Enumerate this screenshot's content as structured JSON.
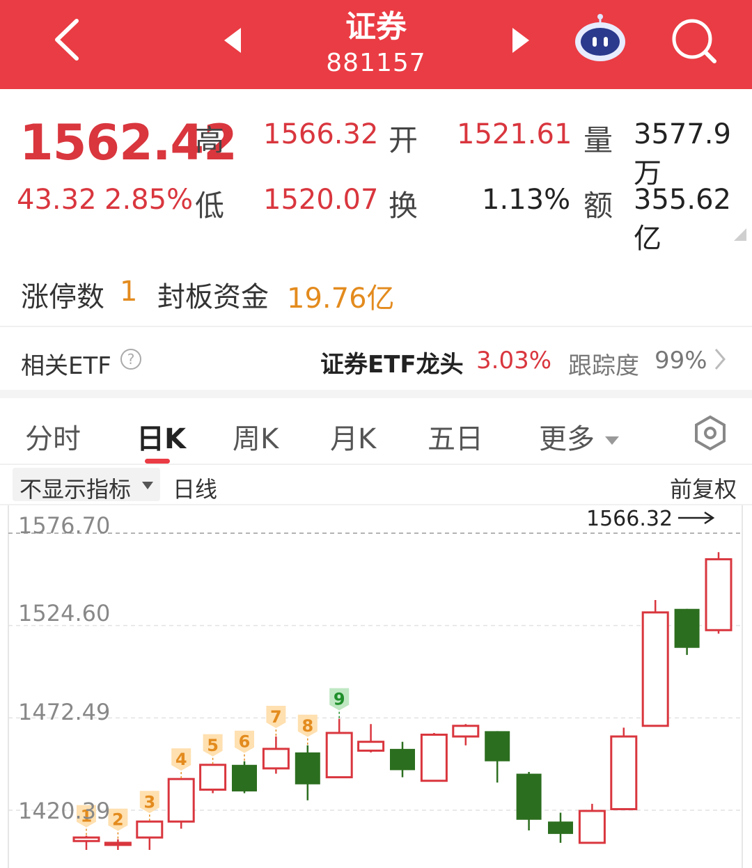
{
  "header": {
    "title": "证券",
    "code": "881157",
    "back_icon": "chevron-left-icon",
    "prev_icon": "triangle-left-icon",
    "next_icon": "triangle-right-icon",
    "robot_icon": "robot-assistant-icon",
    "search_icon": "search-icon"
  },
  "quote": {
    "price": "1562.42",
    "change": "43.32",
    "change_pct": "2.85%",
    "high_label": "高",
    "high": "1566.32",
    "low_label": "低",
    "low": "1520.07",
    "open_label": "开",
    "open": "1521.61",
    "turnover_label": "换",
    "turnover": "1.13%",
    "volume_label": "量",
    "volume": "3577.9万",
    "amount_label": "额",
    "amount": "355.62亿"
  },
  "limit": {
    "count_label": "涨停数",
    "count": "1",
    "fund_label": "封板资金",
    "fund": "19.76亿"
  },
  "etf": {
    "label": "相关ETF",
    "name": "证券ETF龙头",
    "change": "3.03%",
    "tracking_label": "跟踪度",
    "tracking": "99%"
  },
  "tabs": [
    "分时",
    "日K",
    "周K",
    "月K",
    "五日",
    "更多"
  ],
  "chart_header": {
    "indicator": "不显示指标",
    "period": "日线",
    "adjust": "前复权",
    "high_marker": "1566.32"
  },
  "colors": {
    "brand": "#ea3c44",
    "up": "#d9363e",
    "down": "#2c6e1f",
    "orange": "#e38b1e"
  },
  "chart_data": {
    "type": "candlestick",
    "y_ticks": [
      "1576.70",
      "1524.60",
      "1472.49",
      "1420.39"
    ],
    "ylim": [
      1402,
      1590
    ],
    "candles": [
      {
        "o": 1403,
        "h": 1406,
        "l": 1398,
        "c": 1405
      },
      {
        "o": 1401,
        "h": 1404,
        "l": 1398,
        "c": 1402
      },
      {
        "o": 1405,
        "h": 1414,
        "l": 1398,
        "c": 1414
      },
      {
        "o": 1414,
        "h": 1438,
        "l": 1410,
        "c": 1438
      },
      {
        "o": 1432,
        "h": 1446,
        "l": 1430,
        "c": 1446
      },
      {
        "o": 1446,
        "h": 1448,
        "l": 1430,
        "c": 1431
      },
      {
        "o": 1444,
        "h": 1462,
        "l": 1441,
        "c": 1455
      },
      {
        "o": 1453,
        "h": 1457,
        "l": 1426,
        "c": 1435
      },
      {
        "o": 1439,
        "h": 1472,
        "l": 1439,
        "c": 1464
      },
      {
        "o": 1454,
        "h": 1469,
        "l": 1453,
        "c": 1459
      },
      {
        "o": 1455,
        "h": 1459,
        "l": 1439,
        "c": 1443
      },
      {
        "o": 1437,
        "h": 1464,
        "l": 1437,
        "c": 1463
      },
      {
        "o": 1462,
        "h": 1469,
        "l": 1457,
        "c": 1468
      },
      {
        "o": 1465,
        "h": 1465,
        "l": 1436,
        "c": 1448
      },
      {
        "o": 1441,
        "h": 1442,
        "l": 1409,
        "c": 1415
      },
      {
        "o": 1414,
        "h": 1419,
        "l": 1402,
        "c": 1407
      },
      {
        "o": 1402,
        "h": 1424,
        "l": 1402,
        "c": 1420
      },
      {
        "o": 1421,
        "h": 1467,
        "l": 1421,
        "c": 1462
      },
      {
        "o": 1468,
        "h": 1539,
        "l": 1468,
        "c": 1532
      },
      {
        "o": 1534,
        "h": 1534,
        "l": 1508,
        "c": 1512
      },
      {
        "o": 1522,
        "h": 1566,
        "l": 1520,
        "c": 1562
      }
    ],
    "markers": [
      {
        "index": 0,
        "label": "1",
        "color": "orange"
      },
      {
        "index": 1,
        "label": "2",
        "color": "orange"
      },
      {
        "index": 2,
        "label": "3",
        "color": "orange"
      },
      {
        "index": 3,
        "label": "4",
        "color": "orange"
      },
      {
        "index": 4,
        "label": "5",
        "color": "orange"
      },
      {
        "index": 5,
        "label": "6",
        "color": "orange"
      },
      {
        "index": 6,
        "label": "7",
        "color": "orange"
      },
      {
        "index": 7,
        "label": "8",
        "color": "orange"
      },
      {
        "index": 8,
        "label": "9",
        "color": "green"
      }
    ]
  }
}
